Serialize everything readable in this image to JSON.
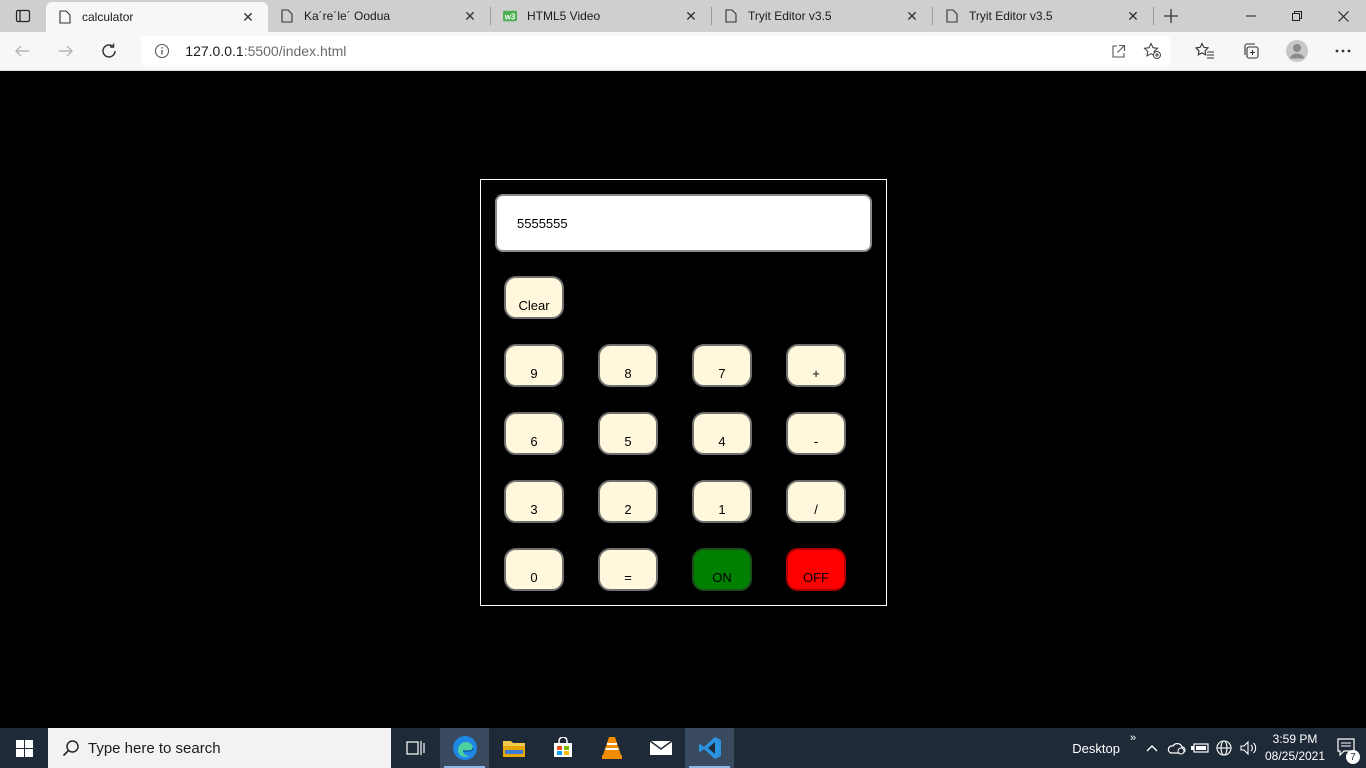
{
  "browser": {
    "tabs": [
      {
        "title": "calculator",
        "icon": "page-icon",
        "active": true
      },
      {
        "title": "Ka´re´le´ Oodua",
        "icon": "page-icon",
        "active": false
      },
      {
        "title": "HTML5 Video",
        "icon": "w3schools-icon",
        "active": false
      },
      {
        "title": "Tryit Editor v3.5",
        "icon": "page-icon",
        "active": false
      },
      {
        "title": "Tryit Editor v3.5",
        "icon": "page-icon",
        "active": false
      }
    ],
    "url_host": "127.0.0.1",
    "url_path": ":5500/index.html"
  },
  "calculator": {
    "display_value": "5555555",
    "keys": {
      "clear": "Clear",
      "k9": "9",
      "k8": "8",
      "k7": "7",
      "plus": "+",
      "k6": "6",
      "k5": "5",
      "k4": "4",
      "minus": "-",
      "k3": "3",
      "k2": "2",
      "k1": "1",
      "divide": "/",
      "k0": "0",
      "equals": "=",
      "on": "ON",
      "off": "OFF"
    },
    "colors": {
      "key_bg": "#fff8dc",
      "on_bg": "#008000",
      "off_bg": "#ff0000"
    }
  },
  "taskbar": {
    "search_placeholder": "Type here to search",
    "desktop_label": "Desktop",
    "time": "3:59 PM",
    "date": "08/25/2021",
    "notification_count": "7"
  }
}
